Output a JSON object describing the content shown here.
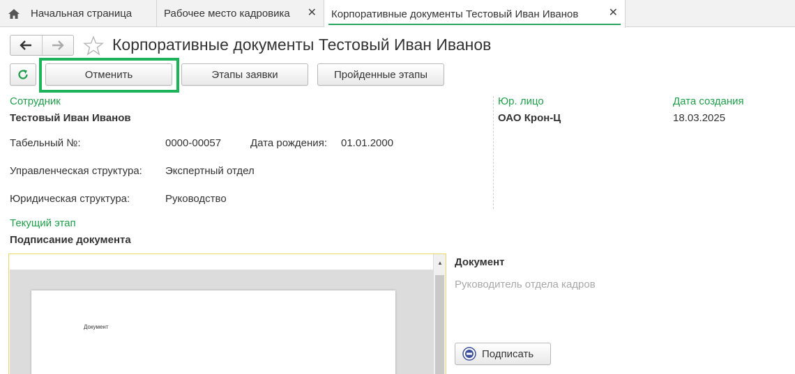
{
  "tabs": [
    {
      "label": "Начальная страница",
      "icon": "home-icon"
    },
    {
      "label": "Рабочее место кадровика",
      "close": "✕"
    },
    {
      "label": "Корпоративные документы Тестовый Иван Иванов",
      "close": "✕",
      "active": true
    }
  ],
  "header": {
    "back_arrow": "🡐",
    "forward_arrow": "🡒",
    "title": "Корпоративные документы Тестовый Иван Иванов"
  },
  "toolbar": {
    "cancel_label": "Отменить",
    "stages_label": "Этапы заявки",
    "passed_label": "Пройденные этапы"
  },
  "employee": {
    "section_label": "Сотрудник",
    "name": "Тестовый Иван Иванов",
    "tab_number_label": "Табельный №:",
    "tab_number": "0000-00057",
    "birth_label": "Дата рождения:",
    "birth_date": "01.01.2000",
    "mgmt_label": "Управленческая структура:",
    "mgmt_value": "Экспертный отдел",
    "legal_label": "Юридическая структура:",
    "legal_value": "Руководство"
  },
  "legal_entity": {
    "label": "Юр. лицо",
    "value": "ОАО Крон-Ц"
  },
  "created": {
    "label": "Дата создания",
    "value": "18.03.2025"
  },
  "stage": {
    "label": "Текущий этап",
    "value": "Подписание документа"
  },
  "document": {
    "preview_text": "Документ",
    "heading": "Документ",
    "signer": "Руководитель отдела кадров",
    "sign_button": "Подписать"
  },
  "colors": {
    "accent_green": "#1e9e4a",
    "highlight": "#1db35a"
  }
}
